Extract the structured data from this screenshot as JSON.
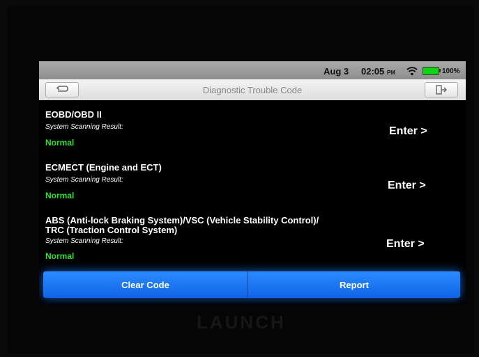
{
  "status": {
    "date": "Aug 3",
    "time": "02:05",
    "ampm": "PM",
    "battery": "100%"
  },
  "header": {
    "title": "Diagnostic Trouble Code",
    "back_icon": "back-icon",
    "exit_icon": "exit-icon"
  },
  "systems": [
    {
      "name": "EOBD/OBD II",
      "label": "System Scanning Result:",
      "status": "Normal",
      "action": "Enter >"
    },
    {
      "name": "ECMECT (Engine and ECT)",
      "label": "System Scanning Result:",
      "status": "Normal",
      "action": "Enter >"
    },
    {
      "name_line1": "ABS (Anti-lock Braking System)/VSC (Vehicle Stability Control)/",
      "name_line2": "TRC (Traction Control System)",
      "label": "System Scanning Result:",
      "status": "Normal",
      "action": "Enter >"
    }
  ],
  "buttons": {
    "clear": "Clear Code",
    "report": "Report"
  },
  "brand": "LAUNCH",
  "colors": {
    "accent": "#1a73f0",
    "normal": "#2fe02f",
    "battery": "#12d312"
  }
}
